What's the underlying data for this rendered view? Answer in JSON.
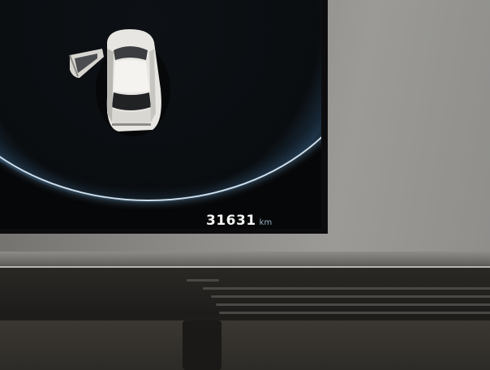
{
  "display": {
    "odometer_value": "31631",
    "odometer_unit": "km"
  },
  "colors": {
    "screen_background": "#060708",
    "ring_glow": "#cfe0ec",
    "car_body": "#e8e6e2",
    "text": "#f2f2f2"
  }
}
